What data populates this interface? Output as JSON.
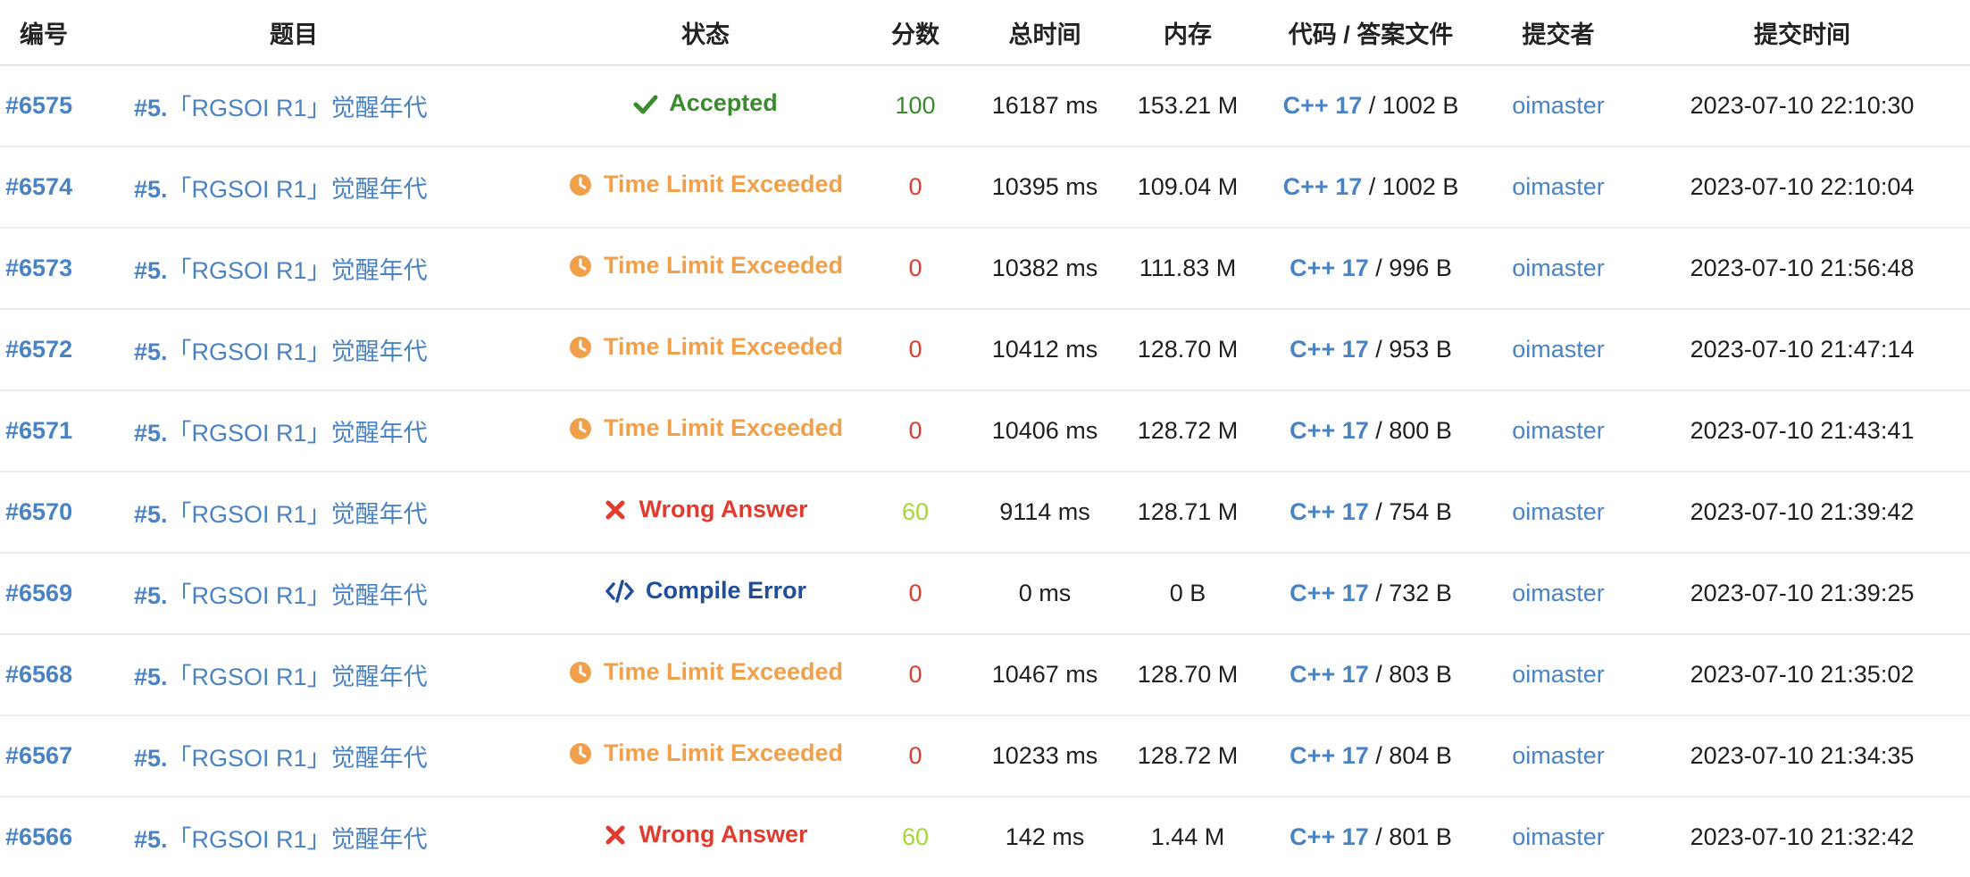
{
  "columns": {
    "id": "编号",
    "problem": "题目",
    "status": "状态",
    "score": "分数",
    "time": "总时间",
    "memory": "内存",
    "code": "代码 / 答案文件",
    "submitter": "提交者",
    "submit_time": "提交时间"
  },
  "status_colors": {
    "accepted": "#3a8a2e",
    "tle": "#f0a04b",
    "wa": "#e23b2e",
    "ce": "#1f4e9a",
    "link": "#4a83c4"
  },
  "score_colors": {
    "100": "#3a8a2e",
    "60": "#a3d63a",
    "0": "#e23b2e"
  },
  "rows": [
    {
      "id": "#6575",
      "problem_num": "#5.",
      "problem_title": "「RGSOI R1」觉醒年代",
      "status": "Accepted",
      "status_key": "accepted",
      "status_icon": "check-icon",
      "score": "100",
      "time": "16187 ms",
      "memory": "153.21 M",
      "lang": "C++ 17",
      "code_size": "1002 B",
      "submitter": "oimaster",
      "submit_time": "2023-07-10 22:10:30"
    },
    {
      "id": "#6574",
      "problem_num": "#5.",
      "problem_title": "「RGSOI R1」觉醒年代",
      "status": "Time Limit Exceeded",
      "status_key": "tle",
      "status_icon": "clock-icon",
      "score": "0",
      "time": "10395 ms",
      "memory": "109.04 M",
      "lang": "C++ 17",
      "code_size": "1002 B",
      "submitter": "oimaster",
      "submit_time": "2023-07-10 22:10:04"
    },
    {
      "id": "#6573",
      "problem_num": "#5.",
      "problem_title": "「RGSOI R1」觉醒年代",
      "status": "Time Limit Exceeded",
      "status_key": "tle",
      "status_icon": "clock-icon",
      "score": "0",
      "time": "10382 ms",
      "memory": "111.83 M",
      "lang": "C++ 17",
      "code_size": "996 B",
      "submitter": "oimaster",
      "submit_time": "2023-07-10 21:56:48"
    },
    {
      "id": "#6572",
      "problem_num": "#5.",
      "problem_title": "「RGSOI R1」觉醒年代",
      "status": "Time Limit Exceeded",
      "status_key": "tle",
      "status_icon": "clock-icon",
      "score": "0",
      "time": "10412 ms",
      "memory": "128.70 M",
      "lang": "C++ 17",
      "code_size": "953 B",
      "submitter": "oimaster",
      "submit_time": "2023-07-10 21:47:14"
    },
    {
      "id": "#6571",
      "problem_num": "#5.",
      "problem_title": "「RGSOI R1」觉醒年代",
      "status": "Time Limit Exceeded",
      "status_key": "tle",
      "status_icon": "clock-icon",
      "score": "0",
      "time": "10406 ms",
      "memory": "128.72 M",
      "lang": "C++ 17",
      "code_size": "800 B",
      "submitter": "oimaster",
      "submit_time": "2023-07-10 21:43:41"
    },
    {
      "id": "#6570",
      "problem_num": "#5.",
      "problem_title": "「RGSOI R1」觉醒年代",
      "status": "Wrong Answer",
      "status_key": "wa",
      "status_icon": "cross-icon",
      "score": "60",
      "time": "9114 ms",
      "memory": "128.71 M",
      "lang": "C++ 17",
      "code_size": "754 B",
      "submitter": "oimaster",
      "submit_time": "2023-07-10 21:39:42"
    },
    {
      "id": "#6569",
      "problem_num": "#5.",
      "problem_title": "「RGSOI R1」觉醒年代",
      "status": "Compile Error",
      "status_key": "ce",
      "status_icon": "code-icon",
      "score": "0",
      "time": "0 ms",
      "memory": "0 B",
      "lang": "C++ 17",
      "code_size": "732 B",
      "submitter": "oimaster",
      "submit_time": "2023-07-10 21:39:25"
    },
    {
      "id": "#6568",
      "problem_num": "#5.",
      "problem_title": "「RGSOI R1」觉醒年代",
      "status": "Time Limit Exceeded",
      "status_key": "tle",
      "status_icon": "clock-icon",
      "score": "0",
      "time": "10467 ms",
      "memory": "128.70 M",
      "lang": "C++ 17",
      "code_size": "803 B",
      "submitter": "oimaster",
      "submit_time": "2023-07-10 21:35:02"
    },
    {
      "id": "#6567",
      "problem_num": "#5.",
      "problem_title": "「RGSOI R1」觉醒年代",
      "status": "Time Limit Exceeded",
      "status_key": "tle",
      "status_icon": "clock-icon",
      "score": "0",
      "time": "10233 ms",
      "memory": "128.72 M",
      "lang": "C++ 17",
      "code_size": "804 B",
      "submitter": "oimaster",
      "submit_time": "2023-07-10 21:34:35"
    },
    {
      "id": "#6566",
      "problem_num": "#5.",
      "problem_title": "「RGSOI R1」觉醒年代",
      "status": "Wrong Answer",
      "status_key": "wa",
      "status_icon": "cross-icon",
      "score": "60",
      "time": "142 ms",
      "memory": "1.44 M",
      "lang": "C++ 17",
      "code_size": "801 B",
      "submitter": "oimaster",
      "submit_time": "2023-07-10 21:32:42"
    }
  ]
}
